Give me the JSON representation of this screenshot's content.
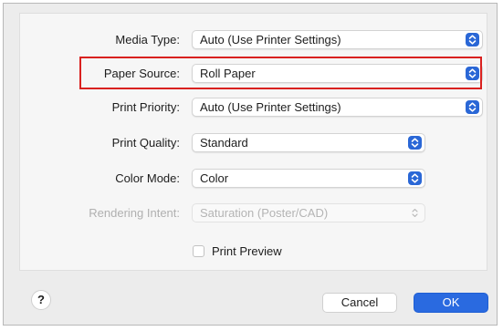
{
  "fields": [
    {
      "label": "Media Type:",
      "value": "Auto (Use Printer Settings)",
      "enabled": true
    },
    {
      "label": "Paper Source:",
      "value": "Roll Paper",
      "enabled": true
    },
    {
      "label": "Print Priority:",
      "value": "Auto (Use Printer Settings)",
      "enabled": true
    },
    {
      "label": "Print Quality:",
      "value": "Standard",
      "enabled": true
    },
    {
      "label": "Color Mode:",
      "value": "Color",
      "enabled": true
    },
    {
      "label": "Rendering Intent:",
      "value": "Saturation (Poster/CAD)",
      "enabled": false
    }
  ],
  "print_preview": {
    "label": "Print Preview",
    "checked": false
  },
  "buttons": {
    "help": "?",
    "cancel": "Cancel",
    "ok": "OK"
  },
  "colors": {
    "accent": "#2a6ae0",
    "highlight": "#d9211f"
  },
  "icons": {
    "stepper": "chevron-up-down-icon",
    "help": "help-icon"
  }
}
